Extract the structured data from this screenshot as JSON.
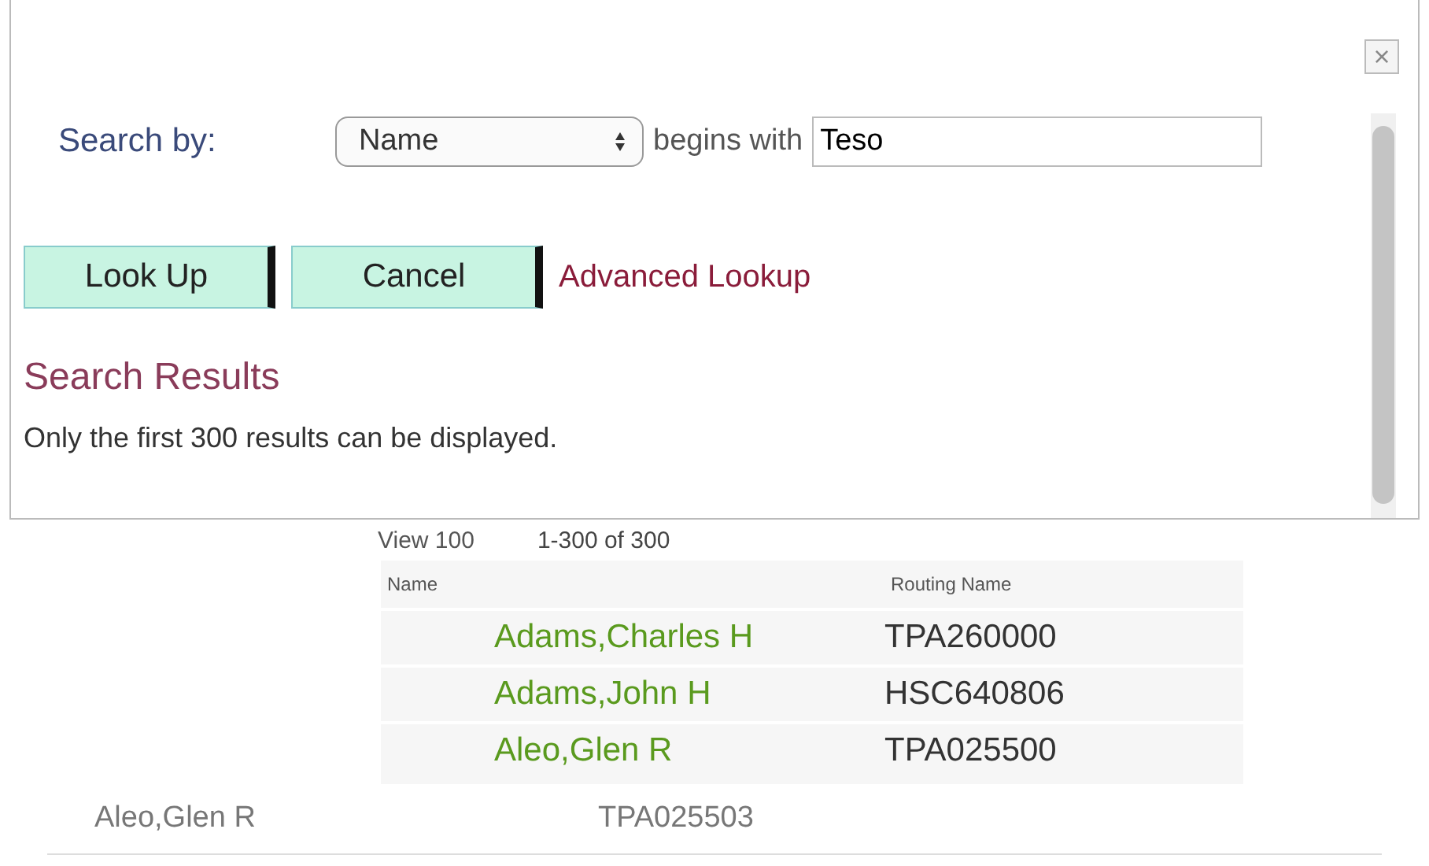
{
  "dialog": {
    "close": "×"
  },
  "search": {
    "label": "Search by:",
    "field": "Name",
    "operator": "begins with",
    "value": "Teso"
  },
  "buttons": [
    "Look Up",
    "Cancel"
  ],
  "advanced_link": "Advanced Lookup",
  "results": {
    "title": "Search Results",
    "note": "Only the first 300 results can be displayed.",
    "view": "View 100",
    "range": "1-300 of 300",
    "columns": [
      "Name",
      "Routing Name"
    ],
    "rows": [
      {
        "cells": [
          "Adams,Charles H",
          "TPA260000"
        ],
        "dimmed": false
      },
      {
        "cells": [
          "Adams,John H",
          "HSC640806"
        ],
        "dimmed": false
      },
      {
        "cells": [
          "Aleo,Glen R",
          "TPA025500"
        ],
        "dimmed": false
      },
      {
        "cells": [
          "Aleo,Glen R",
          "TPA025503"
        ],
        "dimmed": true
      }
    ]
  }
}
